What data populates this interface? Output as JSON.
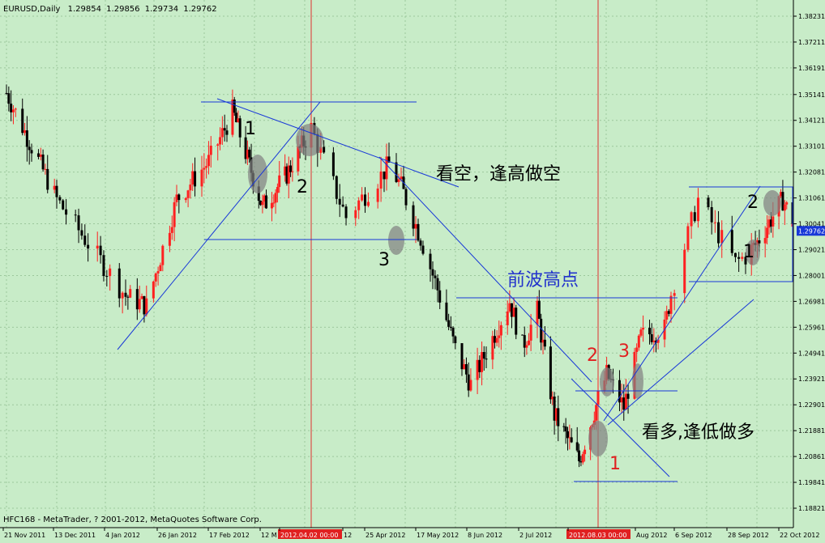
{
  "chart_data": {
    "type": "candlestick",
    "header": {
      "symbol": "EURUSD,Daily",
      "ohlc": [
        "1.29854",
        "1.29856",
        "1.29734",
        "1.29762"
      ]
    },
    "footer": "HFC168 - MetaTrader, ? 2001-2012, MetaQuotes Software Corp.",
    "ylim": [
      1.1882,
      1.3862
    ],
    "y_ticks": [
      "1.38231",
      "1.37211",
      "1.36191",
      "1.35141",
      "1.34121",
      "1.33101",
      "1.32081",
      "1.31061",
      "1.30041",
      "1.29021",
      "1.28001",
      "1.26981",
      "1.25961",
      "1.24941",
      "1.23921",
      "1.22901",
      "1.21881",
      "1.20861",
      "1.19841",
      "1.18821"
    ],
    "current_price": "1.29762",
    "x_labels": [
      "21 Nov 2011",
      "13 Dec 2011",
      "4 Jan 2012",
      "26 Jan 2012",
      "17 Feb 2012",
      "12 M",
      "2012.04.02 00:00",
      "12",
      "25 Apr 2012",
      "17 May 2012",
      "8 Jun 2012",
      "2 Jul 2012",
      "2012.08.03 00:00",
      "Aug 2012",
      "6 Sep 2012",
      "28 Sep 2012",
      "22 Oct 2012"
    ],
    "vertical_markers": [
      "2012.04.02 00:00",
      "2012.08.03 00:00"
    ],
    "annotations": [
      {
        "text": "1",
        "color": "#000000"
      },
      {
        "text": "2",
        "color": "#000000"
      },
      {
        "text": "3",
        "color": "#000000"
      },
      {
        "text": "看空，逢高做空",
        "color": "#000000"
      },
      {
        "text": "前波高点",
        "color": "#2233cc"
      },
      {
        "text": "2",
        "color": "#e02020"
      },
      {
        "text": "3",
        "color": "#e02020"
      },
      {
        "text": "1",
        "color": "#e02020"
      },
      {
        "text": "看多,逢低做多",
        "color": "#000000"
      },
      {
        "text": "2",
        "color": "#000000"
      },
      {
        "text": "1",
        "color": "#000000"
      }
    ],
    "path_keypoints": [
      {
        "date": "2011-11-21",
        "price": 1.352
      },
      {
        "date": "2011-12-13",
        "price": 1.31
      },
      {
        "date": "2012-01-04",
        "price": 1.272
      },
      {
        "date": "2012-01-13",
        "price": 1.268
      },
      {
        "date": "2012-01-26",
        "price": 1.31
      },
      {
        "date": "2012-02-09",
        "price": 1.325
      },
      {
        "date": "2012-02-20",
        "price": 1.345
      },
      {
        "date": "2012-03-07",
        "price": 1.307
      },
      {
        "date": "2012-03-20",
        "price": 1.32
      },
      {
        "date": "2012-04-02",
        "price": 1.338
      },
      {
        "date": "2012-04-13",
        "price": 1.303
      },
      {
        "date": "2012-04-27",
        "price": 1.324
      },
      {
        "date": "2012-05-02",
        "price": 1.315
      },
      {
        "date": "2012-05-10",
        "price": 1.295
      },
      {
        "date": "2012-05-25",
        "price": 1.251
      },
      {
        "date": "2012-06-01",
        "price": 1.237
      },
      {
        "date": "2012-06-19",
        "price": 1.27
      },
      {
        "date": "2012-06-25",
        "price": 1.252
      },
      {
        "date": "2012-07-02",
        "price": 1.266
      },
      {
        "date": "2012-07-11",
        "price": 1.225
      },
      {
        "date": "2012-07-24",
        "price": 1.207
      },
      {
        "date": "2012-08-07",
        "price": 1.241
      },
      {
        "date": "2012-08-15",
        "price": 1.228
      },
      {
        "date": "2012-08-23",
        "price": 1.256
      },
      {
        "date": "2012-09-03",
        "price": 1.259
      },
      {
        "date": "2012-09-14",
        "price": 1.31
      },
      {
        "date": "2012-09-25",
        "price": 1.285
      },
      {
        "date": "2012-10-03",
        "price": 1.292
      },
      {
        "date": "2012-10-17",
        "price": 1.31
      },
      {
        "date": "2012-10-24",
        "price": 1.298
      }
    ]
  }
}
